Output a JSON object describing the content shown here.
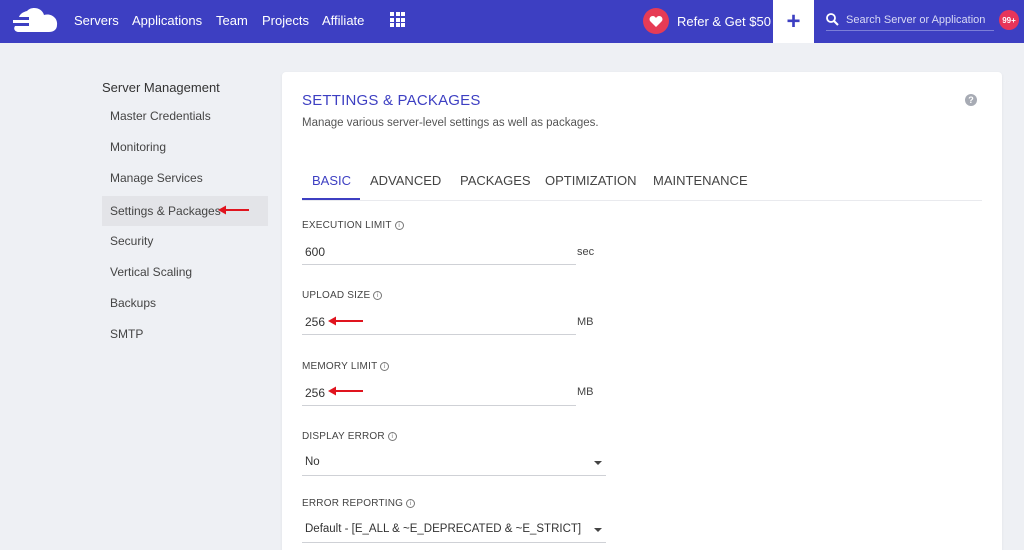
{
  "nav": {
    "links": [
      "Servers",
      "Applications",
      "Team",
      "Projects",
      "Affiliate"
    ],
    "refer_label": "Refer & Get $50",
    "plus_label": "+",
    "search_placeholder": "Search Server or Application",
    "notification_badge": "99+"
  },
  "sidebar": {
    "title": "Server Management",
    "items": [
      {
        "label": "Master Credentials"
      },
      {
        "label": "Monitoring"
      },
      {
        "label": "Manage Services"
      },
      {
        "label": "Settings & Packages",
        "active": true
      },
      {
        "label": "Security"
      },
      {
        "label": "Vertical Scaling"
      },
      {
        "label": "Backups"
      },
      {
        "label": "SMTP"
      }
    ]
  },
  "main": {
    "title": "SETTINGS & PACKAGES",
    "subtitle": "Manage various server-level settings as well as packages.",
    "help": "?",
    "tabs": [
      {
        "label": "BASIC",
        "active": true
      },
      {
        "label": "ADVANCED"
      },
      {
        "label": "PACKAGES"
      },
      {
        "label": "OPTIMIZATION"
      },
      {
        "label": "MAINTENANCE"
      }
    ],
    "fields": {
      "execution_limit": {
        "label": "EXECUTION LIMIT",
        "value": "600",
        "unit": "sec"
      },
      "upload_size": {
        "label": "UPLOAD SIZE",
        "value": "256",
        "unit": "MB"
      },
      "memory_limit": {
        "label": "MEMORY LIMIT",
        "value": "256",
        "unit": "MB"
      },
      "display_error": {
        "label": "DISPLAY ERROR",
        "value": "No"
      },
      "error_reporting": {
        "label": "ERROR REPORTING",
        "value": "Default - [E_ALL & ~E_DEPRECATED & ~E_STRICT]"
      }
    },
    "info_glyph": "i"
  },
  "colors": {
    "nav_bg": "#3d3fc2",
    "accent": "#3d3fc2",
    "heart": "#e63b55",
    "badge": "#e7355a",
    "annotation_arrow": "#e0141e"
  },
  "icons": [
    "cloud-logo-icon",
    "apps-grid-icon",
    "heart-icon",
    "plus-icon",
    "search-icon",
    "help-icon",
    "info-icon",
    "chevron-down-icon",
    "red-arrow-icon"
  ]
}
